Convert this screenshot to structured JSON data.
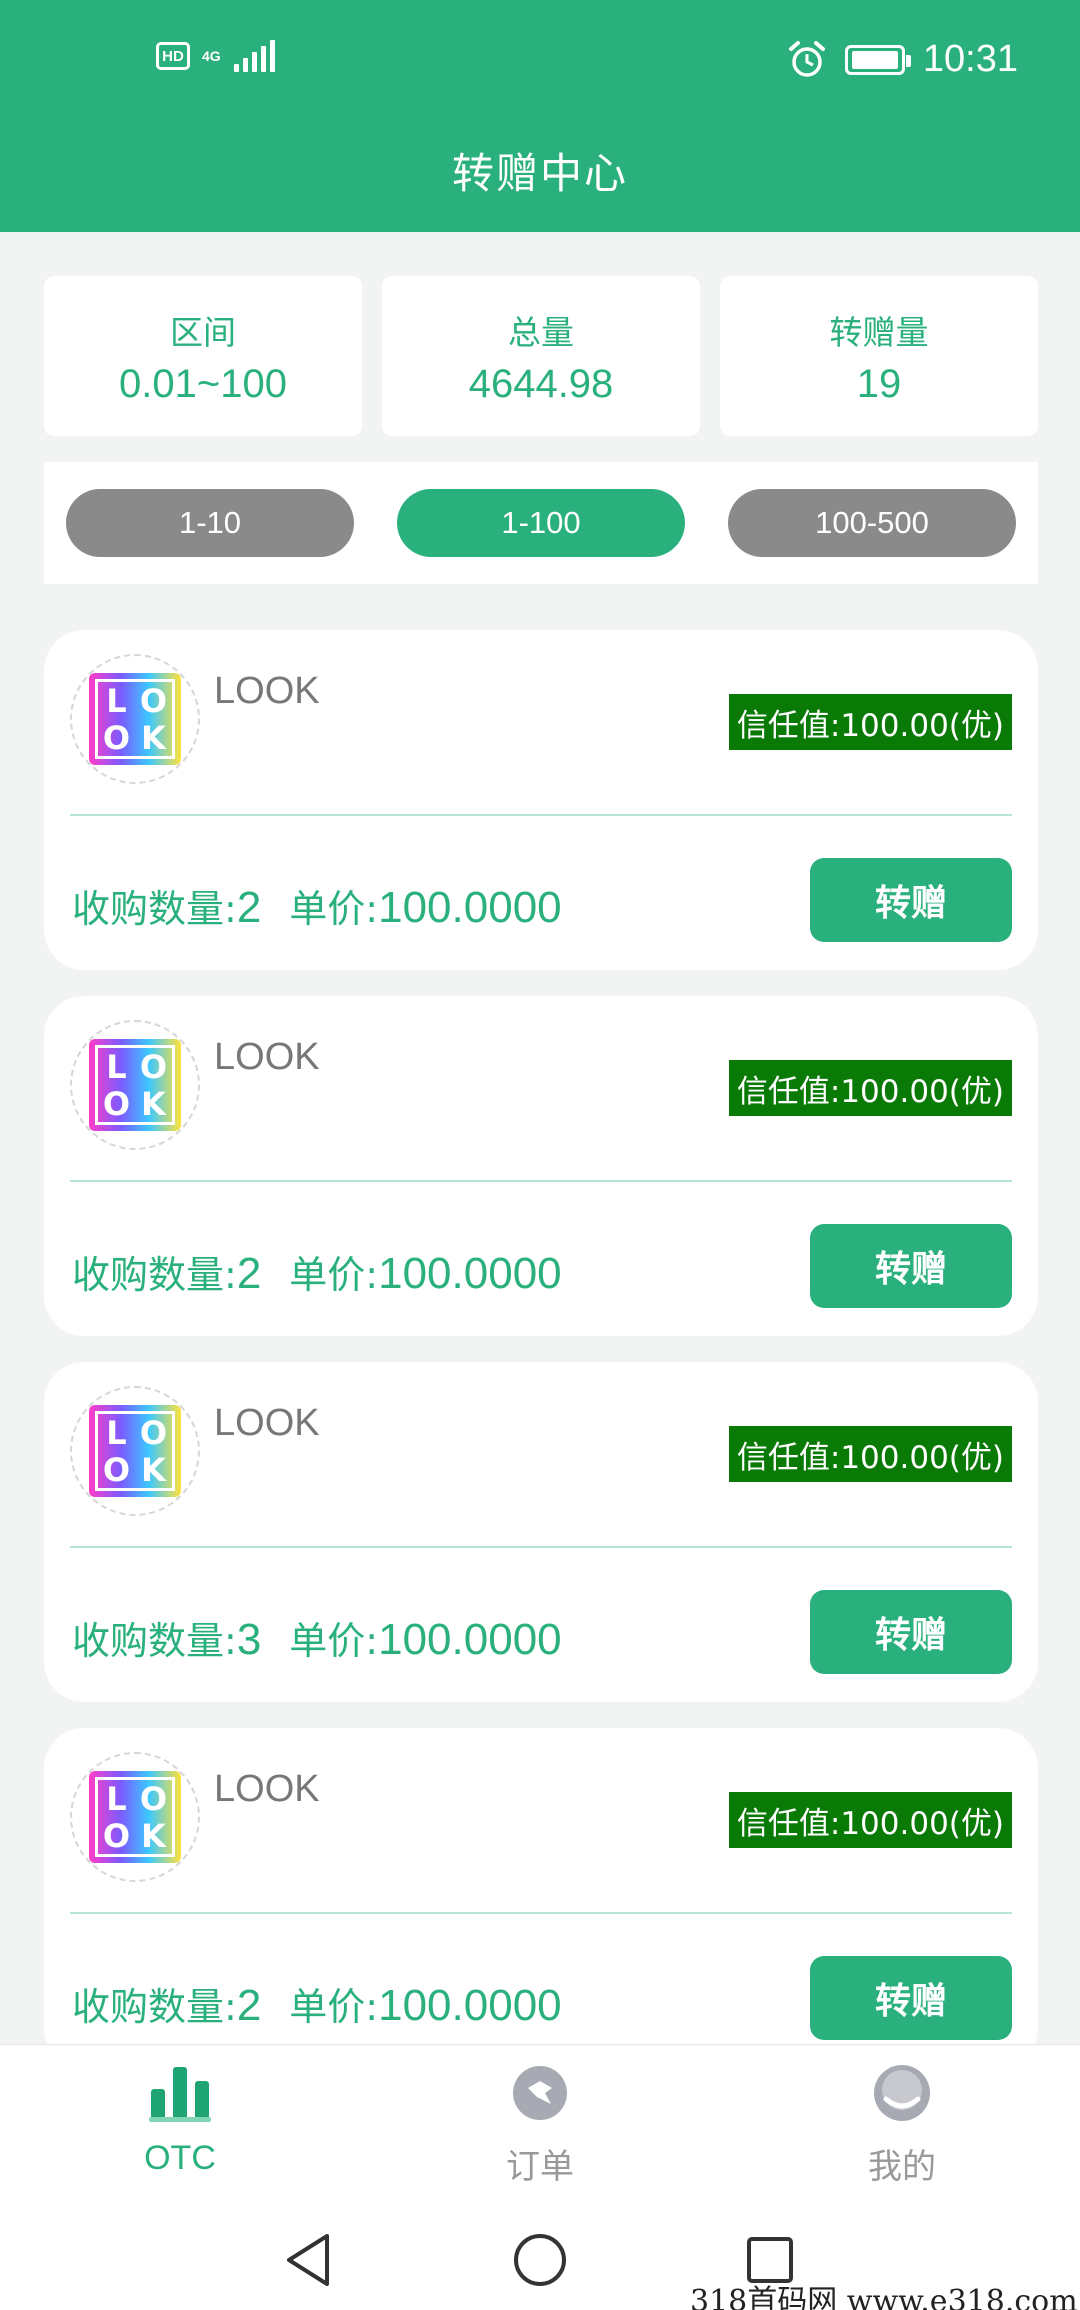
{
  "status_bar": {
    "hd_badge": "HD",
    "network": "4G",
    "time": "10:31"
  },
  "page": {
    "title": "转赠中心"
  },
  "stats": [
    {
      "label": "区间",
      "value": "0.01~100"
    },
    {
      "label": "总量",
      "value": "4644.98"
    },
    {
      "label": "转赠量",
      "value": "19"
    }
  ],
  "ranges": [
    {
      "label": "1-10",
      "active": false
    },
    {
      "label": "1-100",
      "active": true
    },
    {
      "label": "100-500",
      "active": false
    }
  ],
  "offers": [
    {
      "name": "LOOK",
      "logo": [
        "L",
        "O",
        "O",
        "K"
      ],
      "trust": "信任值:100.00(优)",
      "qty_label": "收购数量:",
      "qty": "2",
      "price_label": "单价:",
      "price": "100.0000",
      "button": "转赠"
    },
    {
      "name": "LOOK",
      "logo": [
        "L",
        "O",
        "O",
        "K"
      ],
      "trust": "信任值:100.00(优)",
      "qty_label": "收购数量:",
      "qty": "2",
      "price_label": "单价:",
      "price": "100.0000",
      "button": "转赠"
    },
    {
      "name": "LOOK",
      "logo": [
        "L",
        "O",
        "O",
        "K"
      ],
      "trust": "信任值:100.00(优)",
      "qty_label": "收购数量:",
      "qty": "3",
      "price_label": "单价:",
      "price": "100.0000",
      "button": "转赠"
    },
    {
      "name": "LOOK",
      "logo": [
        "L",
        "O",
        "O",
        "K"
      ],
      "trust": "信任值:100.00(优)",
      "qty_label": "收购数量:",
      "qty": "2",
      "price_label": "单价:",
      "price": "100.0000",
      "button": "转赠"
    }
  ],
  "bottom_nav": [
    {
      "label": "OTC",
      "icon": "bar-chart-icon",
      "active": true
    },
    {
      "label": "订单",
      "icon": "order-icon",
      "active": false
    },
    {
      "label": "我的",
      "icon": "profile-icon",
      "active": false
    }
  ],
  "system_nav": {
    "back": "back-icon",
    "home": "home-icon",
    "recents": "recents-icon"
  },
  "watermark": "318首码网  www.e318.com",
  "colors": {
    "primary": "#2ab07d",
    "trust_badge": "#0a7a07",
    "inactive_pill": "#8a8a8a"
  }
}
